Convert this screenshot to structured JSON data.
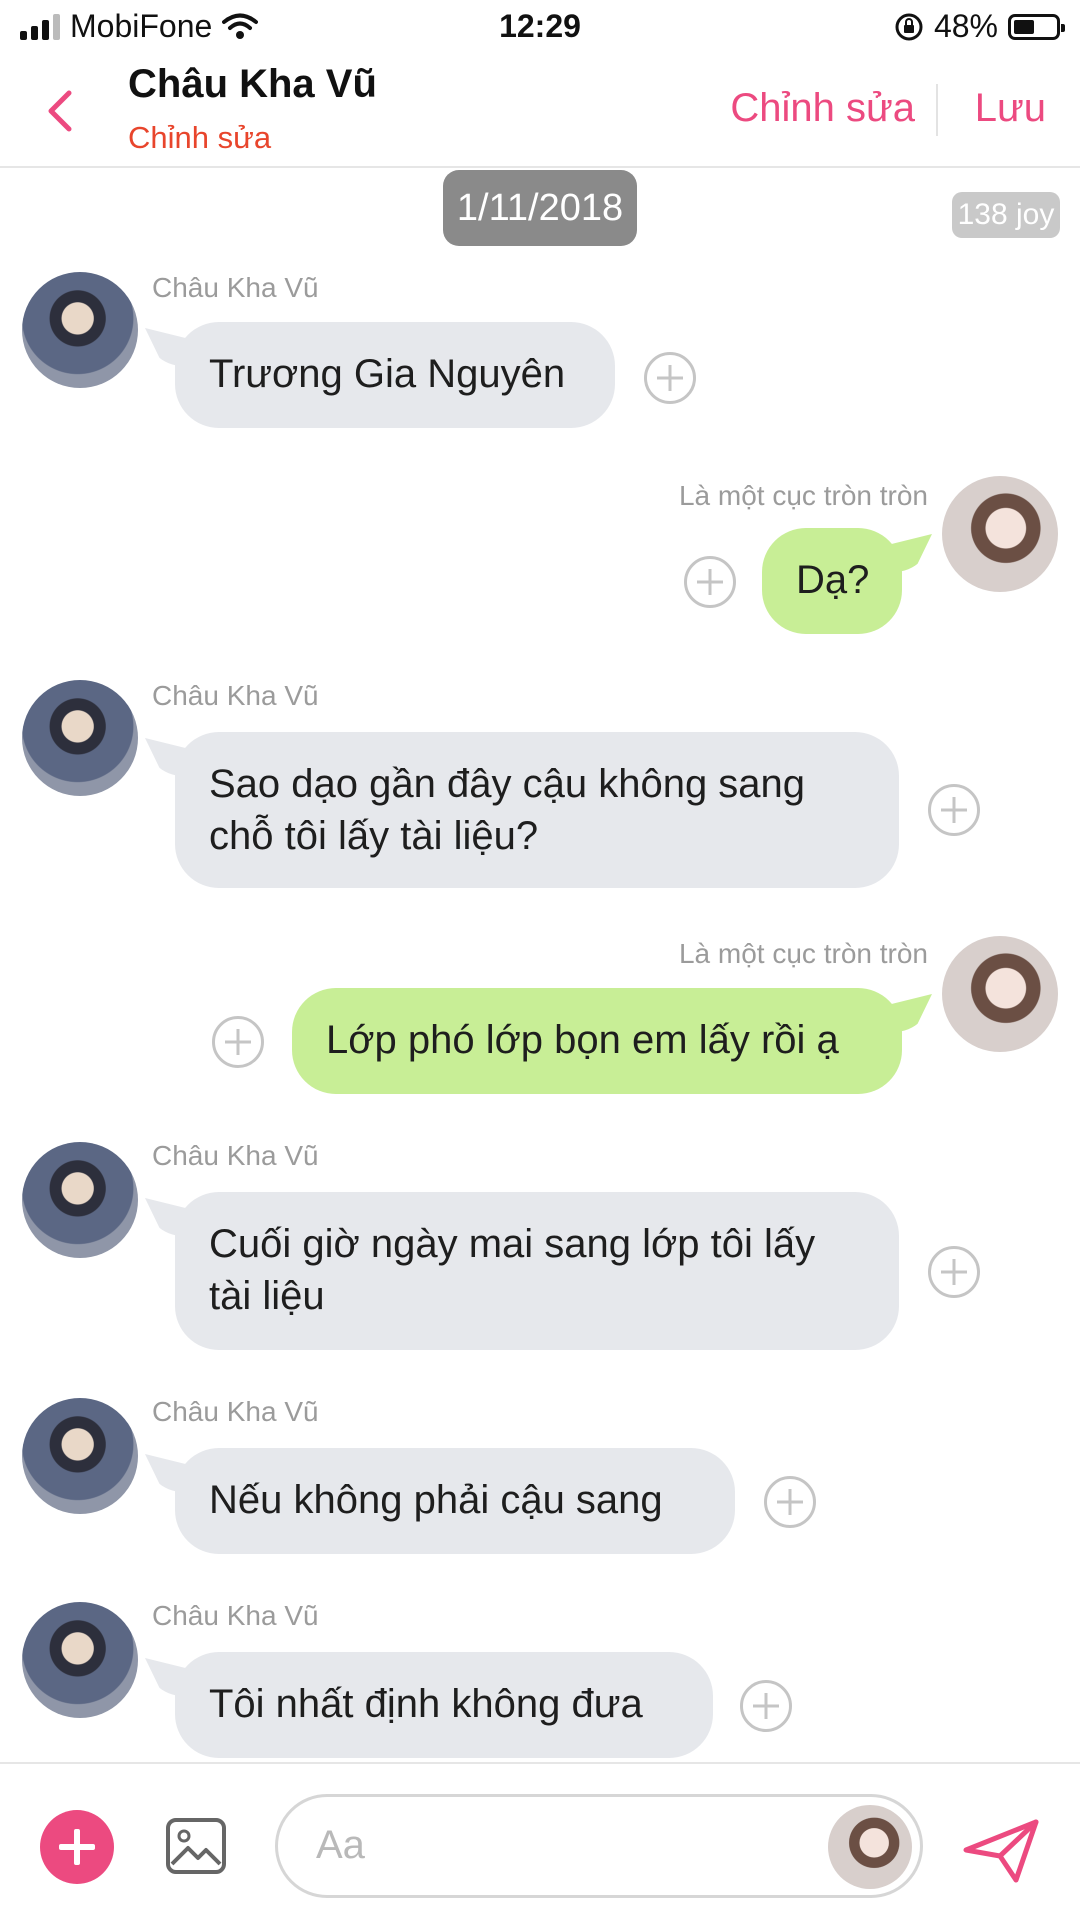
{
  "status_bar": {
    "carrier": "MobiFone",
    "time": "12:29",
    "battery": "48%"
  },
  "header": {
    "title": "Châu Kha Vũ",
    "subtitle": "Chỉnh sửa",
    "edit_label": "Chỉnh sửa",
    "save_label": "Lưu"
  },
  "chat": {
    "date": "1/11/2018",
    "joy_badge": "138 joy",
    "messages": [
      {
        "sender": "Châu Kha Vũ",
        "text": "Trương Gia Nguyên",
        "side": "left"
      },
      {
        "sender": "Là một cục tròn tròn",
        "text": "Dạ?",
        "side": "right"
      },
      {
        "sender": "Châu Kha Vũ",
        "text": "Sao dạo gần đây cậu không sang chỗ tôi lấy tài liệu?",
        "side": "left"
      },
      {
        "sender": "Là một cục tròn tròn",
        "text": "Lớp phó lớp bọn em lấy rồi ạ",
        "side": "right"
      },
      {
        "sender": "Châu Kha Vũ",
        "text": "Cuối giờ ngày mai sang lớp tôi lấy tài liệu",
        "side": "left"
      },
      {
        "sender": "Châu Kha Vũ",
        "text": "Nếu không phải cậu sang",
        "side": "left"
      },
      {
        "sender": "Châu Kha Vũ",
        "text": "Tôi nhất định không đưa",
        "side": "left"
      }
    ]
  },
  "composer": {
    "placeholder": "Aa"
  },
  "colors": {
    "accent": "#ec4a80",
    "subtitle": "#e8452c",
    "received_bubble": "#e6e8ec",
    "sent_bubble": "#c8ee96"
  },
  "icons": [
    "back-chevron-icon",
    "wifi-icon",
    "rotation-lock-icon",
    "plus-icon",
    "image-icon",
    "send-icon"
  ]
}
